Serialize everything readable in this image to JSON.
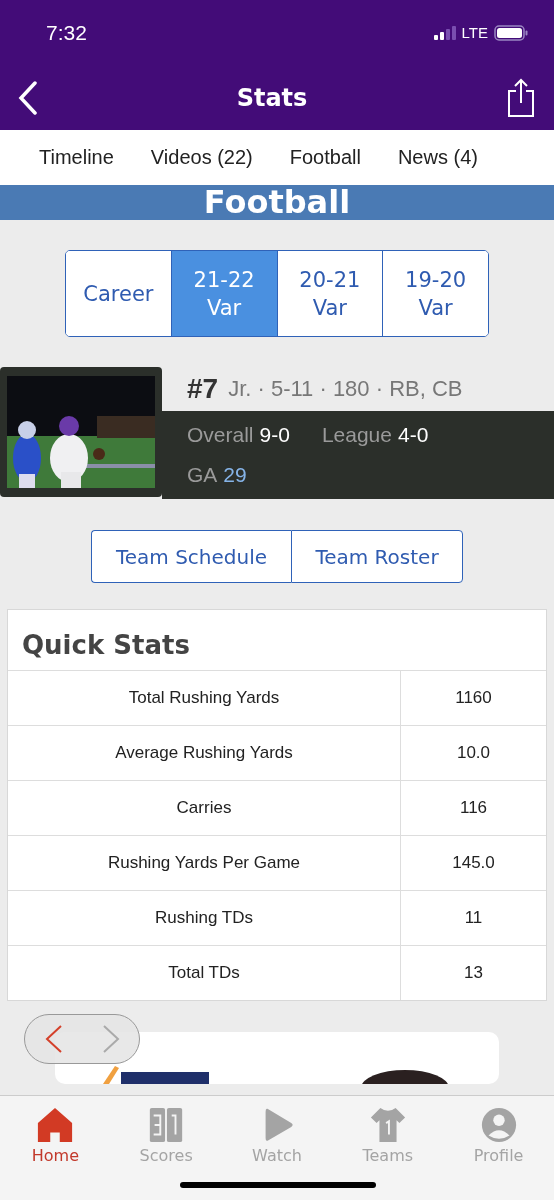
{
  "status_bar": {
    "time": "7:32",
    "network": "LTE"
  },
  "nav": {
    "title": "Stats"
  },
  "tabs": [
    {
      "label": "Timeline"
    },
    {
      "label": "Videos (22)"
    },
    {
      "label": "Football"
    },
    {
      "label": "News (4)"
    }
  ],
  "banner": {
    "title": "Football"
  },
  "seasons": [
    {
      "lines": [
        "Career"
      ],
      "selected": false
    },
    {
      "lines": [
        "21-22",
        "Var"
      ],
      "selected": true
    },
    {
      "lines": [
        "20-21",
        "Var"
      ],
      "selected": false
    },
    {
      "lines": [
        "19-20",
        "Var"
      ],
      "selected": false
    }
  ],
  "player": {
    "number": "#7",
    "info": "Jr. · 5-11 · 180 · RB, CB",
    "records": [
      {
        "label": "Overall",
        "value": "9-0"
      },
      {
        "label": "League",
        "value": "4-0"
      }
    ],
    "ga": {
      "label": "GA",
      "value": "29"
    }
  },
  "links": [
    "Team Schedule",
    "Team Roster"
  ],
  "quick_stats": {
    "title": "Quick Stats",
    "rows": [
      {
        "stat": "Total Rushing Yards",
        "value": "1160"
      },
      {
        "stat": "Average Rushing Yards",
        "value": "10.0"
      },
      {
        "stat": "Carries",
        "value": "116"
      },
      {
        "stat": "Rushing Yards Per Game",
        "value": "145.0"
      },
      {
        "stat": "Rushing TDs",
        "value": "11"
      },
      {
        "stat": "Total TDs",
        "value": "13"
      }
    ]
  },
  "bottom_nav": [
    {
      "kind": "home",
      "label": "Home",
      "selected": true
    },
    {
      "kind": "scores",
      "label": "Scores",
      "selected": false
    },
    {
      "kind": "watch",
      "label": "Watch",
      "selected": false
    },
    {
      "kind": "teams",
      "label": "Teams",
      "selected": false
    },
    {
      "kind": "profile",
      "label": "Profile",
      "selected": false
    }
  ]
}
